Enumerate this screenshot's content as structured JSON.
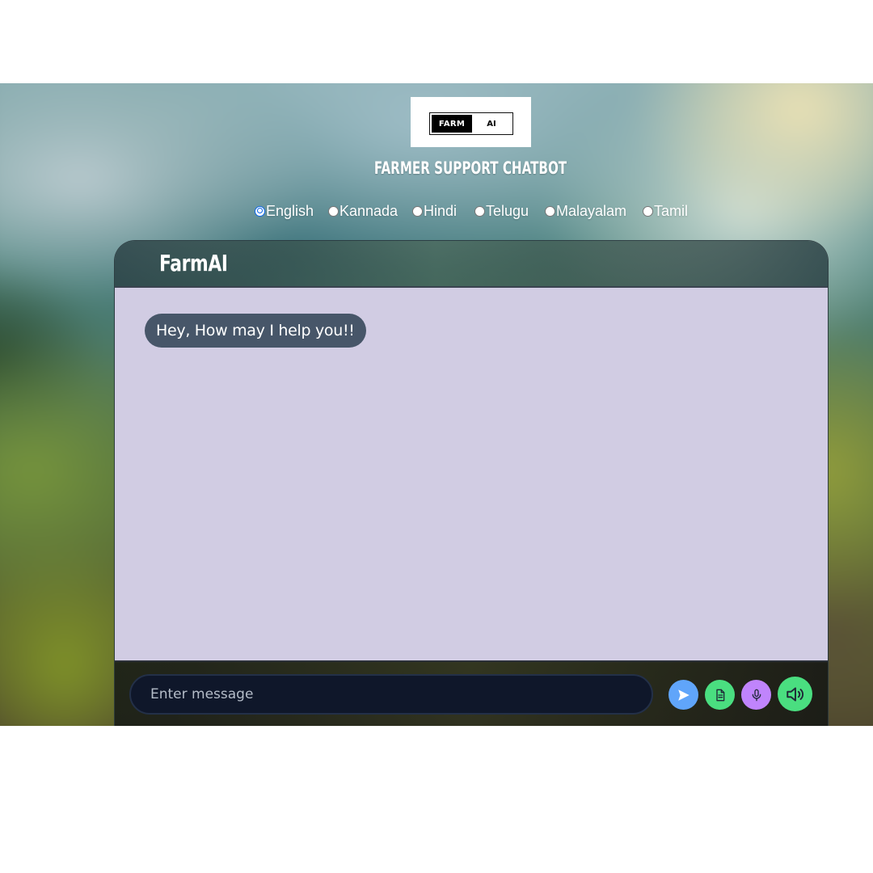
{
  "logo": {
    "part1": "FARM",
    "part2": "AI"
  },
  "page_title": "FARMER SUPPORT CHATBOT",
  "languages": {
    "selected": "English",
    "options": [
      {
        "label": "English",
        "checked": true
      },
      {
        "label": "Kannada",
        "checked": false
      },
      {
        "label": "Hindi",
        "checked": false
      },
      {
        "label": "Telugu",
        "checked": false
      },
      {
        "label": "Malayalam",
        "checked": false
      },
      {
        "label": "Tamil",
        "checked": false
      }
    ]
  },
  "chat": {
    "header_title": "FarmAI",
    "messages": [
      {
        "sender": "bot",
        "text": "Hey, How may I help you!!"
      }
    ],
    "input": {
      "value": "",
      "placeholder": "Enter message"
    },
    "buttons": {
      "send": {
        "icon": "send-icon",
        "color": "#60a5fa"
      },
      "document": {
        "icon": "document-icon",
        "color": "#4ade80"
      },
      "microphone": {
        "icon": "microphone-icon",
        "color": "#c084fc"
      },
      "speaker": {
        "icon": "speaker-icon",
        "color": "#4ade80"
      }
    }
  },
  "colors": {
    "chat_body_bg": "#d1cce3",
    "bot_bubble_bg": "#475669",
    "input_bg": "#0f172a",
    "radio_checked": "#0a66e8"
  }
}
